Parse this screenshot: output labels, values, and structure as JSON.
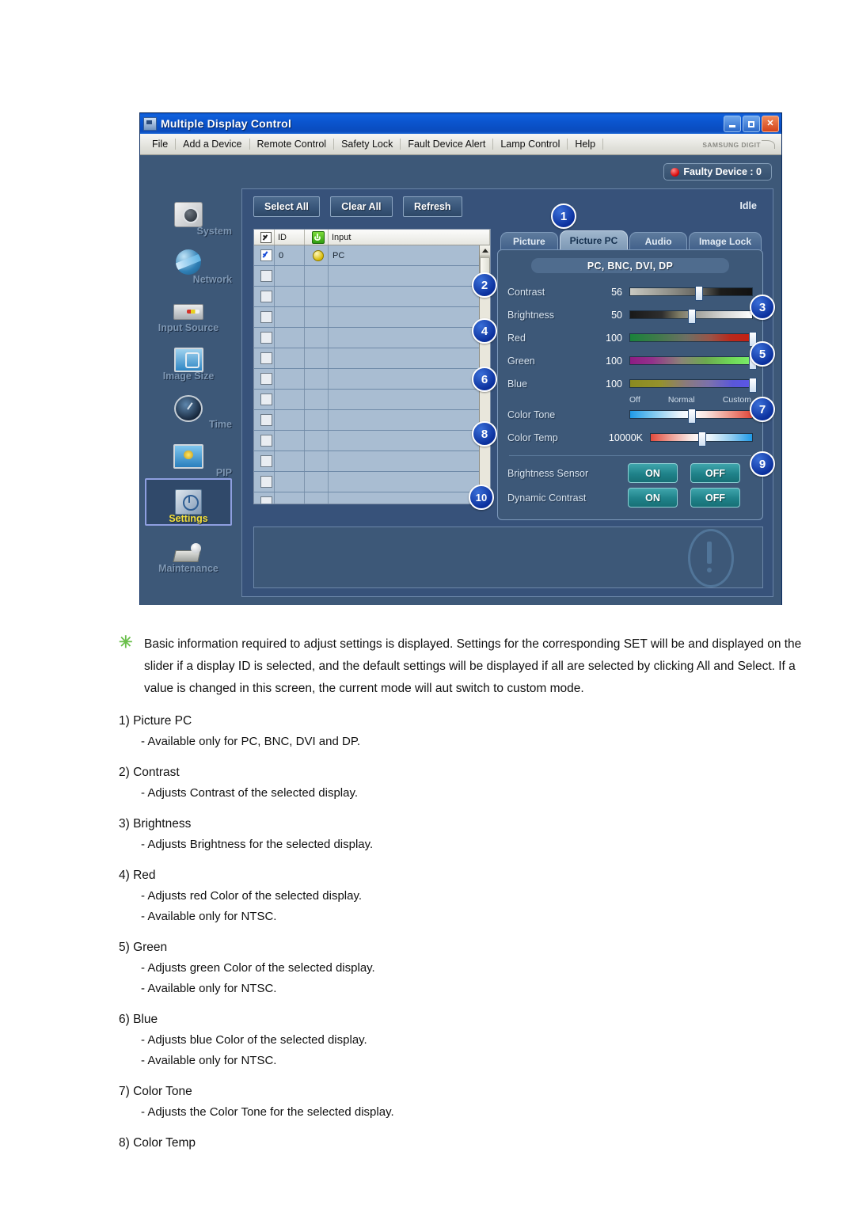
{
  "window": {
    "title": "Multiple Display Control",
    "controls": {
      "minimize": "minimize-button",
      "maximize": "maximize-button",
      "close": "close-button"
    },
    "menu": [
      "File",
      "Add a Device",
      "Remote Control",
      "Safety Lock",
      "Fault Device Alert",
      "Lamp Control",
      "Help"
    ],
    "brand": "SAMSUNG DIGIT",
    "faulty_device": "Faulty Device : 0",
    "status": "Idle"
  },
  "sidebar": {
    "items": [
      {
        "label": "System",
        "icon": "system-icon",
        "active": false
      },
      {
        "label": "Network",
        "icon": "network-icon",
        "active": false
      },
      {
        "label": "Input Source",
        "icon": "input-source-icon",
        "active": false
      },
      {
        "label": "Image Size",
        "icon": "image-size-icon",
        "active": false
      },
      {
        "label": "Time",
        "icon": "time-icon",
        "active": false
      },
      {
        "label": "PIP",
        "icon": "pip-icon",
        "active": false
      },
      {
        "label": "Settings",
        "icon": "settings-icon",
        "active": true
      },
      {
        "label": "Maintenance",
        "icon": "maintenance-icon",
        "active": false
      }
    ]
  },
  "toolbar": {
    "select_all": "Select All",
    "clear_all": "Clear All",
    "refresh": "Refresh"
  },
  "device_table": {
    "columns": [
      "",
      "ID",
      "",
      "Input"
    ],
    "rows": [
      {
        "checked": true,
        "id": "0",
        "power": "on",
        "input": "PC"
      },
      {
        "checked": false,
        "id": "",
        "power": "",
        "input": ""
      },
      {
        "checked": false,
        "id": "",
        "power": "",
        "input": ""
      },
      {
        "checked": false,
        "id": "",
        "power": "",
        "input": ""
      },
      {
        "checked": false,
        "id": "",
        "power": "",
        "input": ""
      },
      {
        "checked": false,
        "id": "",
        "power": "",
        "input": ""
      },
      {
        "checked": false,
        "id": "",
        "power": "",
        "input": ""
      },
      {
        "checked": false,
        "id": "",
        "power": "",
        "input": ""
      },
      {
        "checked": false,
        "id": "",
        "power": "",
        "input": ""
      },
      {
        "checked": false,
        "id": "",
        "power": "",
        "input": ""
      },
      {
        "checked": false,
        "id": "",
        "power": "",
        "input": ""
      },
      {
        "checked": false,
        "id": "",
        "power": "",
        "input": ""
      },
      {
        "checked": false,
        "id": "",
        "power": "",
        "input": ""
      }
    ]
  },
  "tabs": [
    {
      "label": "Picture",
      "active": false
    },
    {
      "label": "Picture PC",
      "active": true
    },
    {
      "label": "Audio",
      "active": false
    },
    {
      "label": "Image Lock",
      "active": false
    }
  ],
  "settings": {
    "mode_pill": "PC, BNC, DVI, DP",
    "sliders": [
      {
        "label": "Contrast",
        "value": "56",
        "pct": 56
      },
      {
        "label": "Brightness",
        "value": "50",
        "pct": 50
      },
      {
        "label": "Red",
        "value": "100",
        "pct": 100
      },
      {
        "label": "Green",
        "value": "100",
        "pct": 100
      },
      {
        "label": "Blue",
        "value": "100",
        "pct": 100
      }
    ],
    "color_tone": {
      "label": "Color Tone",
      "ticks": [
        "Off",
        "Normal",
        "Custom"
      ],
      "pct": 50
    },
    "color_temp": {
      "label": "Color Temp",
      "value": "10000K",
      "pct": 50
    },
    "toggles": [
      {
        "label": "Brightness Sensor",
        "on": "ON",
        "off": "OFF"
      },
      {
        "label": "Dynamic Contrast",
        "on": "ON",
        "off": "OFF"
      }
    ]
  },
  "callouts": [
    "1",
    "2",
    "3",
    "4",
    "5",
    "6",
    "7",
    "8",
    "9",
    "10"
  ],
  "doc": {
    "note": "Basic information required to adjust settings is displayed. Settings for the corresponding SET will be and displayed on the slider if a display ID is selected, and the default settings will be displayed if all are selected by clicking All and Select. If a value is changed in this screen, the current mode will aut switch to custom mode.",
    "items": [
      {
        "title": "1) Picture PC",
        "subs": [
          "- Available only for PC, BNC, DVI and DP."
        ]
      },
      {
        "title": "2) Contrast",
        "subs": [
          "- Adjusts Contrast of the selected display."
        ]
      },
      {
        "title": "3) Brightness",
        "subs": [
          "- Adjusts Brightness for the selected display."
        ]
      },
      {
        "title": "4) Red",
        "subs": [
          "- Adjusts red Color of the selected display.",
          "- Available only for NTSC."
        ]
      },
      {
        "title": "5) Green",
        "subs": [
          "- Adjusts green Color of the selected display.",
          "- Available only for NTSC."
        ]
      },
      {
        "title": "6) Blue",
        "subs": [
          "- Adjusts blue Color of the selected display.",
          "- Available only for NTSC."
        ]
      },
      {
        "title": "7) Color Tone",
        "subs": [
          "- Adjusts the Color Tone for the selected display."
        ]
      },
      {
        "title": "8) Color Temp",
        "subs": []
      }
    ]
  }
}
